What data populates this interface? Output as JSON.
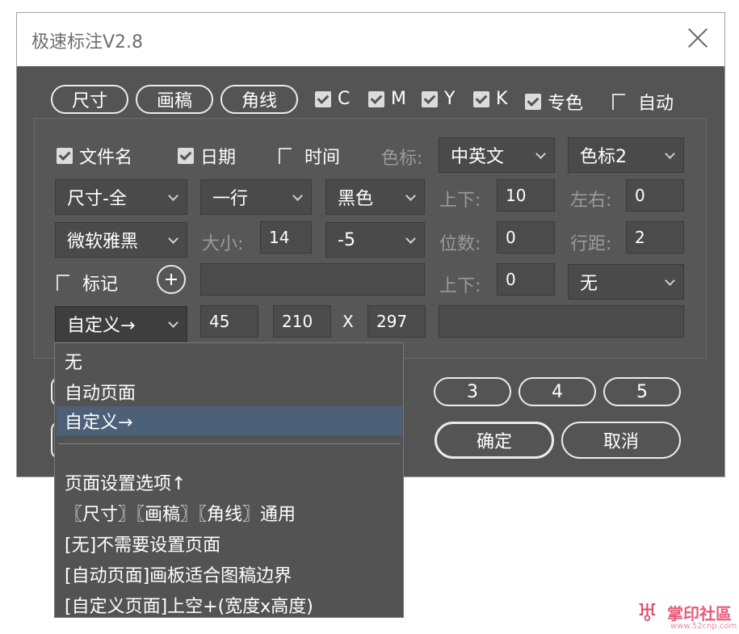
{
  "window": {
    "title": "极速标注V2.8"
  },
  "top_buttons": [
    "尺寸",
    "画稿",
    "角线"
  ],
  "colors": [
    {
      "label": "C",
      "checked": true
    },
    {
      "label": "M",
      "checked": true
    },
    {
      "label": "Y",
      "checked": true
    },
    {
      "label": "K",
      "checked": true
    },
    {
      "label": "专色",
      "checked": true
    },
    {
      "label": "自动",
      "checked": false
    }
  ],
  "row1": {
    "filename_label": "文件名",
    "date_label": "日期",
    "time_label": "时间",
    "color_mark_label": "色标:",
    "color_mark_lang": "中英文",
    "color_mark_style": "色标2"
  },
  "row2": {
    "size_mode": "尺寸-全",
    "lines": "一行",
    "color": "黑色",
    "updown_label": "上下:",
    "updown_value": "10",
    "leftright_label": "左右:",
    "leftright_value": "0"
  },
  "row3": {
    "font": "微软雅黑",
    "size_label": "大小:",
    "size_value": "14",
    "offset": "-5",
    "digits_label": "位数:",
    "digits_value": "0",
    "linespace_label": "行距:",
    "linespace_value": "2"
  },
  "row4": {
    "mark_label": "标记",
    "mark_text": "",
    "updown_label": "上下:",
    "updown_value": "0",
    "mark_option": "无"
  },
  "row5": {
    "page_mode": "自定义→",
    "top_space": "45",
    "width": "210",
    "x_label": "X",
    "height": "297",
    "extra": ""
  },
  "bottom_buttons": {
    "b3": "3",
    "b4": "4",
    "b5": "5",
    "ok": "确定",
    "cancel": "取消"
  },
  "dropdown": {
    "options": [
      "无",
      "自动页面",
      "自定义→"
    ],
    "selected_index": 2,
    "description": [
      "页面设置选项↑",
      "〖尺寸〗〖画稿〗〖角线〗通用",
      "[无]不需要设置页面",
      "[自动页面]画板适合图稿边界",
      "[自定义页面]上空+(宽度x高度)"
    ]
  },
  "watermark": {
    "text": "掌印社區",
    "url": "www.52cnp.com"
  },
  "accent": {
    "selection": "#4c6178",
    "background": "#545454"
  }
}
